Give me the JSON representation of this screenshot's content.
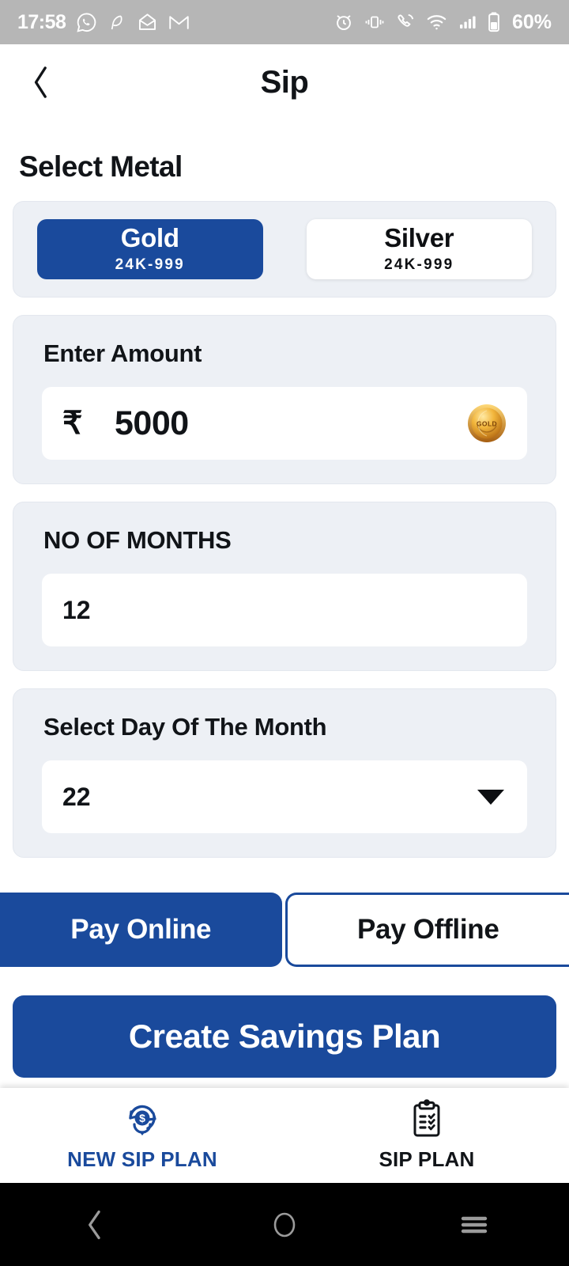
{
  "statusbar": {
    "time": "17:58",
    "battery": "60%",
    "left_icons": [
      "whatsapp-icon",
      "feather-icon",
      "envelope-icon",
      "gmail-icon"
    ],
    "right_icons": [
      "alarm-icon",
      "vibrate-icon",
      "call-icon",
      "wifi-icon",
      "signal-icon",
      "battery-icon"
    ]
  },
  "header": {
    "title": "Sip",
    "back_icon": "chevron-left-icon"
  },
  "page": {
    "section_title": "Select Metal"
  },
  "metal": {
    "options": [
      {
        "name": "Gold",
        "purity": "24K-999",
        "selected": true
      },
      {
        "name": "Silver",
        "purity": "24K-999",
        "selected": false
      }
    ]
  },
  "amount": {
    "label": "Enter Amount",
    "currency_symbol": "₹",
    "value": "5000",
    "badge_icon": "gold-coin-icon",
    "badge_text": "GOLD"
  },
  "months": {
    "label": "NO OF MONTHS",
    "value": "12"
  },
  "day": {
    "label": "Select Day Of The Month",
    "value": "22",
    "arrow_icon": "caret-down-icon"
  },
  "payment": {
    "online_label": "Pay Online",
    "offline_label": "Pay Offline"
  },
  "cta": {
    "label": "Create Savings Plan"
  },
  "bottomnav": {
    "items": [
      {
        "label": "NEW SIP PLAN",
        "icon": "refresh-dollar-icon",
        "active": true
      },
      {
        "label": "SIP PLAN",
        "icon": "clipboard-checklist-icon",
        "active": false
      }
    ]
  },
  "androidnav": {
    "back_icon": "chevron-left-icon",
    "home_icon": "circle-icon",
    "recents_icon": "hamburger-icon"
  },
  "colors": {
    "brand_blue": "#1a4a9c",
    "card_bg": "#edf0f5",
    "text_dark": "#111418",
    "statusbar_bg": "#b6b6b6",
    "gold": "#e0a421"
  }
}
